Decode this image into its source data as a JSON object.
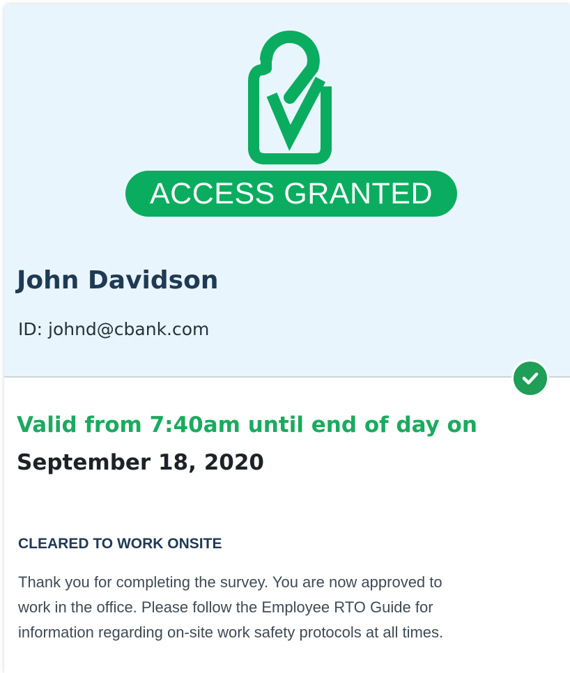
{
  "colors": {
    "accent_green": "#0aad5f",
    "valid_green": "#1aaa5e",
    "header_bg": "#e9f5fd",
    "name_navy": "#1f3a55"
  },
  "header": {
    "icon": "lock-check-icon",
    "status_label": "ACCESS GRANTED"
  },
  "user": {
    "name": "John Davidson",
    "id_line": "ID: johnd@cbank.com"
  },
  "status_check_icon": "checkmark-circle-icon",
  "validity": {
    "line1": "Valid from 7:40am until end of day on",
    "date": "September 18, 2020"
  },
  "clearance": {
    "heading": "CLEARED TO WORK ONSITE",
    "message_lines": [
      "Thank you for completing the survey. You are now approved to",
      "work in the office. Please follow the Employee RTO Guide for",
      "information regarding on-site work safety protocols at all times."
    ]
  }
}
